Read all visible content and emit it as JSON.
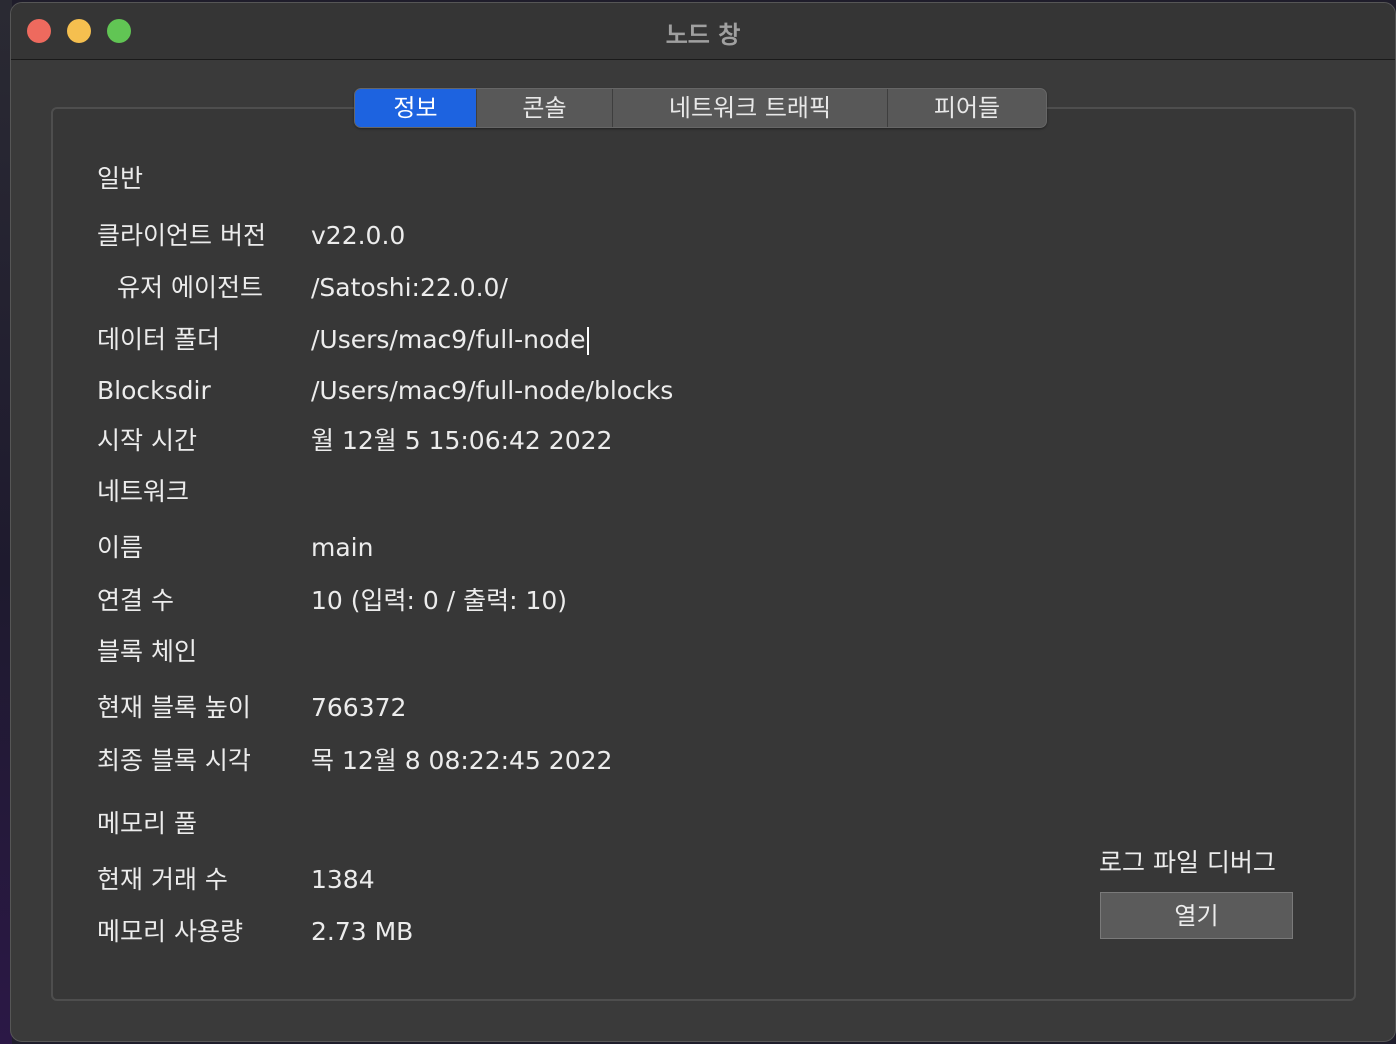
{
  "window": {
    "title": "노드 창"
  },
  "tabs": [
    {
      "label": "정보",
      "active": true
    },
    {
      "label": "콘솔",
      "active": false
    },
    {
      "label": "네트워크 트래픽",
      "active": false
    },
    {
      "label": "피어들",
      "active": false
    }
  ],
  "general": {
    "heading": "일반",
    "client_version_label": "클라이언트 버전",
    "client_version": "v22.0.0",
    "user_agent_label": "유저 에이전트",
    "user_agent": "/Satoshi:22.0.0/",
    "data_dir_label": "데이터 폴더",
    "data_dir": "/Users/mac9/full-node",
    "blocksdir_label": "Blocksdir",
    "blocksdir": "/Users/mac9/full-node/blocks",
    "startup_time_label": "시작 시간",
    "startup_time": "월 12월 5 15:06:42 2022"
  },
  "network": {
    "heading": "네트워크",
    "name_label": "이름",
    "name": "main",
    "connections_label": "연결 수",
    "connections": "10 (입력: 0 / 출력: 10)"
  },
  "blockchain": {
    "heading": "블록 체인",
    "height_label": "현재 블록 높이",
    "height": "766372",
    "last_block_label": "최종 블록 시각",
    "last_block_time": "목 12월 8 08:22:45 2022"
  },
  "mempool": {
    "heading": "메모리 풀",
    "tx_count_label": "현재 거래 수",
    "tx_count": "1384",
    "memory_label": "메모리 사용량",
    "memory_usage": "2.73 MB"
  },
  "debug": {
    "label": "로그 파일 디버그",
    "open_button": "열기"
  }
}
